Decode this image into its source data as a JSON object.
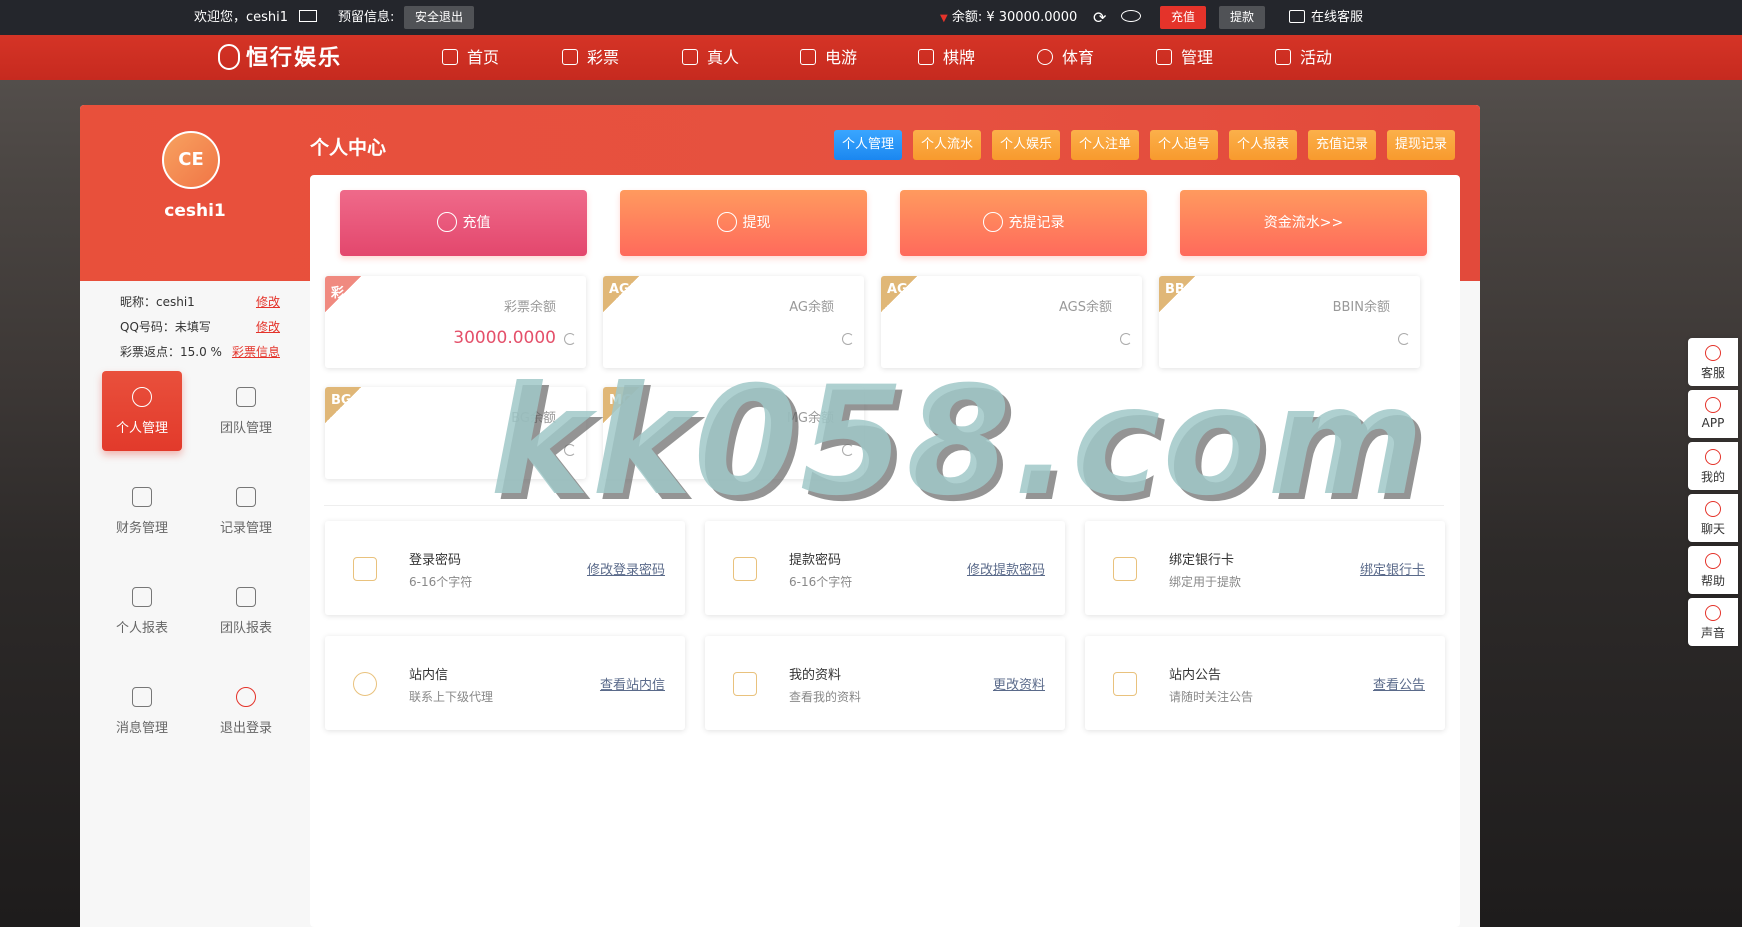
{
  "topbar": {
    "welcome": "欢迎您，ceshi1",
    "reserved_label": "预留信息:",
    "logout_safe": "安全退出",
    "balance": "余额: ¥ 30000.0000",
    "recharge": "充值",
    "withdraw": "提款",
    "online_service": "在线客服"
  },
  "nav": {
    "logo": "恒行娱乐",
    "items": [
      "首页",
      "彩票",
      "真人",
      "电游",
      "棋牌",
      "体育",
      "管理",
      "活动"
    ]
  },
  "profile": {
    "avatar_text": "CE",
    "username": "ceshi1",
    "nickname": "昵称：ceshi1",
    "nickname_link": "修改",
    "qq": "QQ号码：未填写",
    "qq_link": "修改",
    "rebate": "彩票返点：15.0 %",
    "rebate_link": "彩票信息"
  },
  "side_menu": [
    "个人管理",
    "团队管理",
    "财务管理",
    "记录管理",
    "个人报表",
    "团队报表",
    "消息管理",
    "退出登录"
  ],
  "page_title": "个人中心",
  "tabs": [
    "个人管理",
    "个人流水",
    "个人娱乐",
    "个人注单",
    "个人追号",
    "个人报表",
    "充值记录",
    "提现记录"
  ],
  "actions": [
    "充值",
    "提现",
    "充提记录",
    "资金流水>>"
  ],
  "wallets": [
    {
      "tag": "彩",
      "label": "彩票余额",
      "value": "30000.0000"
    },
    {
      "tag": "AG",
      "label": "AG余额",
      "value": ""
    },
    {
      "tag": "AG",
      "label": "AGS余额",
      "value": ""
    },
    {
      "tag": "BB",
      "label": "BBIN余额",
      "value": ""
    },
    {
      "tag": "BG",
      "label": "BG余额",
      "value": ""
    },
    {
      "tag": "MG",
      "label": "MG余额",
      "value": ""
    }
  ],
  "cards": [
    {
      "title": "登录密码",
      "sub": "6-16个字符",
      "link": "修改登录密码"
    },
    {
      "title": "提款密码",
      "sub": "6-16个字符",
      "link": "修改提款密码"
    },
    {
      "title": "绑定银行卡",
      "sub": "绑定用于提款",
      "link": "绑定银行卡"
    },
    {
      "title": "站内信",
      "sub": "联系上下级代理",
      "link": "查看站内信"
    },
    {
      "title": "我的资料",
      "sub": "查看我的资料",
      "link": "更改资料"
    },
    {
      "title": "站内公告",
      "sub": "请随时关注公告",
      "link": "查看公告"
    }
  ],
  "float_bar": [
    "客服",
    "APP",
    "我的",
    "聊天",
    "帮助",
    "声音"
  ],
  "watermark": "kk058.com"
}
